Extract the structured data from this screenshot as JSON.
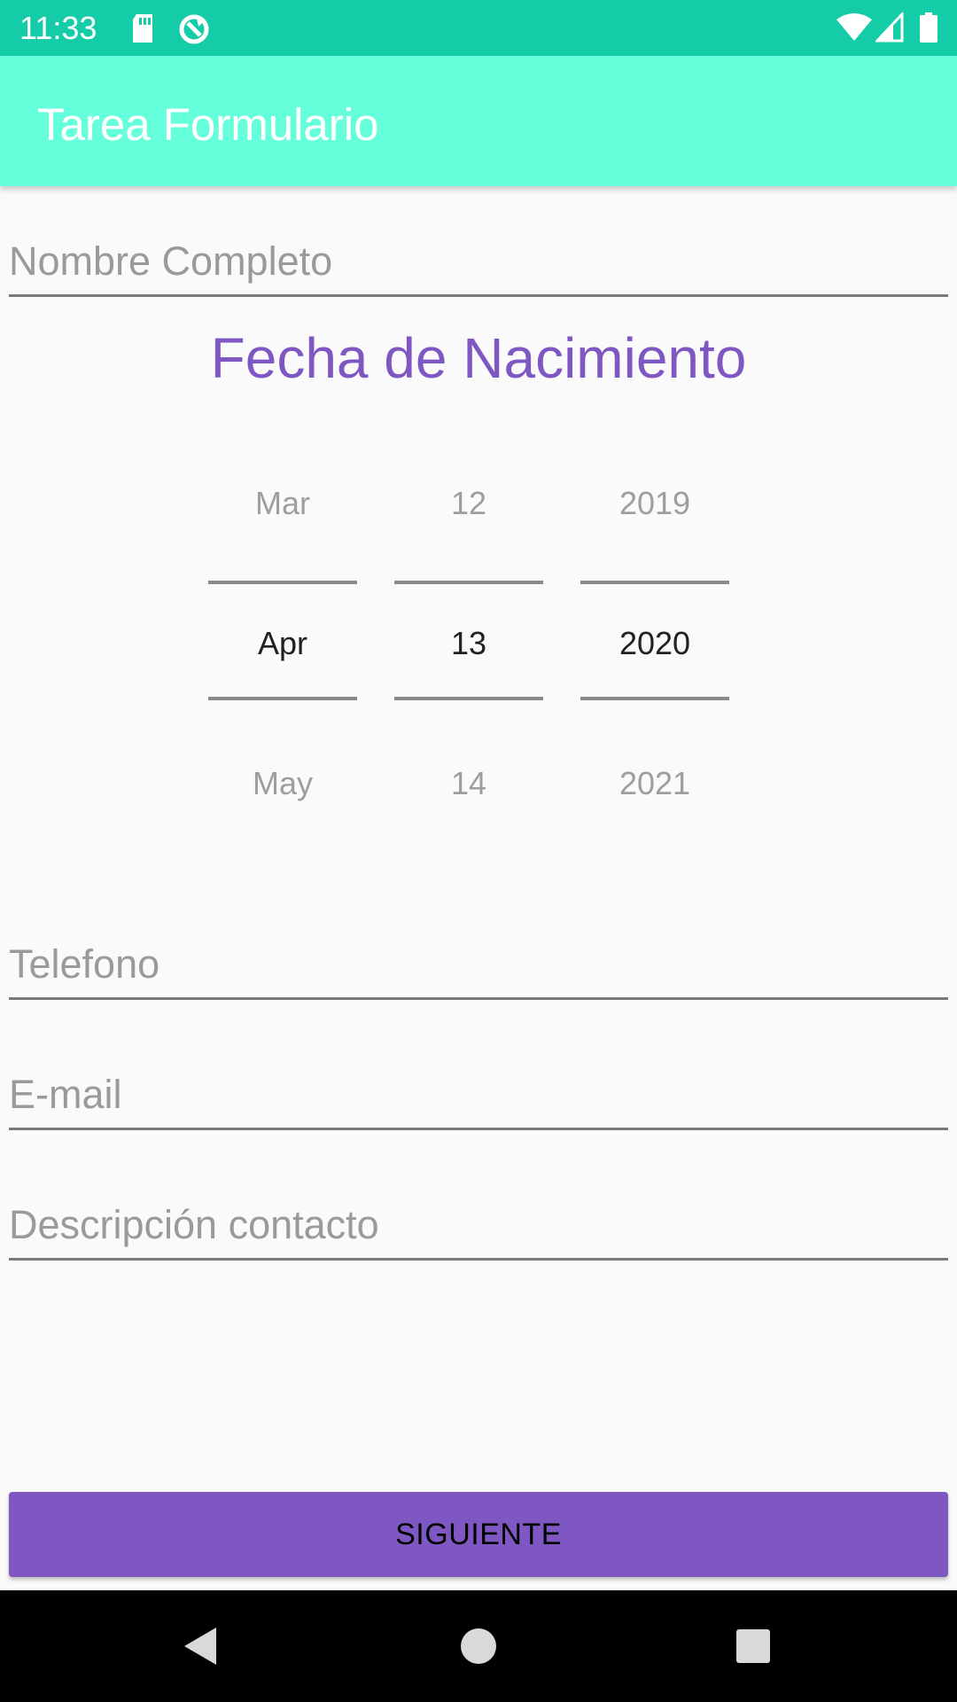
{
  "status_bar": {
    "time": "11:33",
    "icons": [
      "sd-card-icon",
      "sync-icon",
      "wifi-icon",
      "signal-icon",
      "battery-icon"
    ],
    "background_color": "#14cca8"
  },
  "app_bar": {
    "title": "Tarea Formulario",
    "background_color": "#66ffdb"
  },
  "form": {
    "full_name": {
      "placeholder": "Nombre Completo",
      "value": ""
    },
    "birth_date_title": "Fecha de Nacimiento",
    "date_picker": {
      "month": {
        "prev": "Mar",
        "current": "Apr",
        "next": "May"
      },
      "day": {
        "prev": "12",
        "current": "13",
        "next": "14"
      },
      "year": {
        "prev": "2019",
        "current": "2020",
        "next": "2021"
      }
    },
    "phone": {
      "placeholder": "Telefono",
      "value": ""
    },
    "email": {
      "placeholder": "E-mail",
      "value": ""
    },
    "description": {
      "placeholder": "Descripción contacto",
      "value": ""
    },
    "next_button": "SIGUIENTE"
  },
  "colors": {
    "accent": "#7e57c2",
    "title_text": "#7e57c2"
  },
  "nav_bar": {
    "buttons": [
      "back-icon",
      "home-icon",
      "recents-icon"
    ]
  }
}
